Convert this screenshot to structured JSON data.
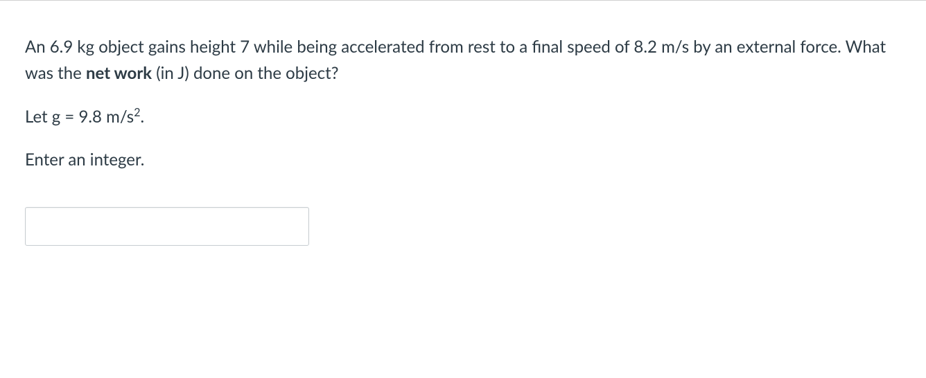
{
  "question": {
    "part1": "An 6.9 kg object gains height 7 while being accelerated from rest to a final speed of 8.2 m/s by an external force.  What was the ",
    "bold": "net work",
    "part2": " (in J) done on the object?"
  },
  "given": {
    "prefix": "Let g = 9.8 m/s",
    "exponent": "2",
    "suffix": "."
  },
  "instruction": "Enter an integer.",
  "answer_value": ""
}
